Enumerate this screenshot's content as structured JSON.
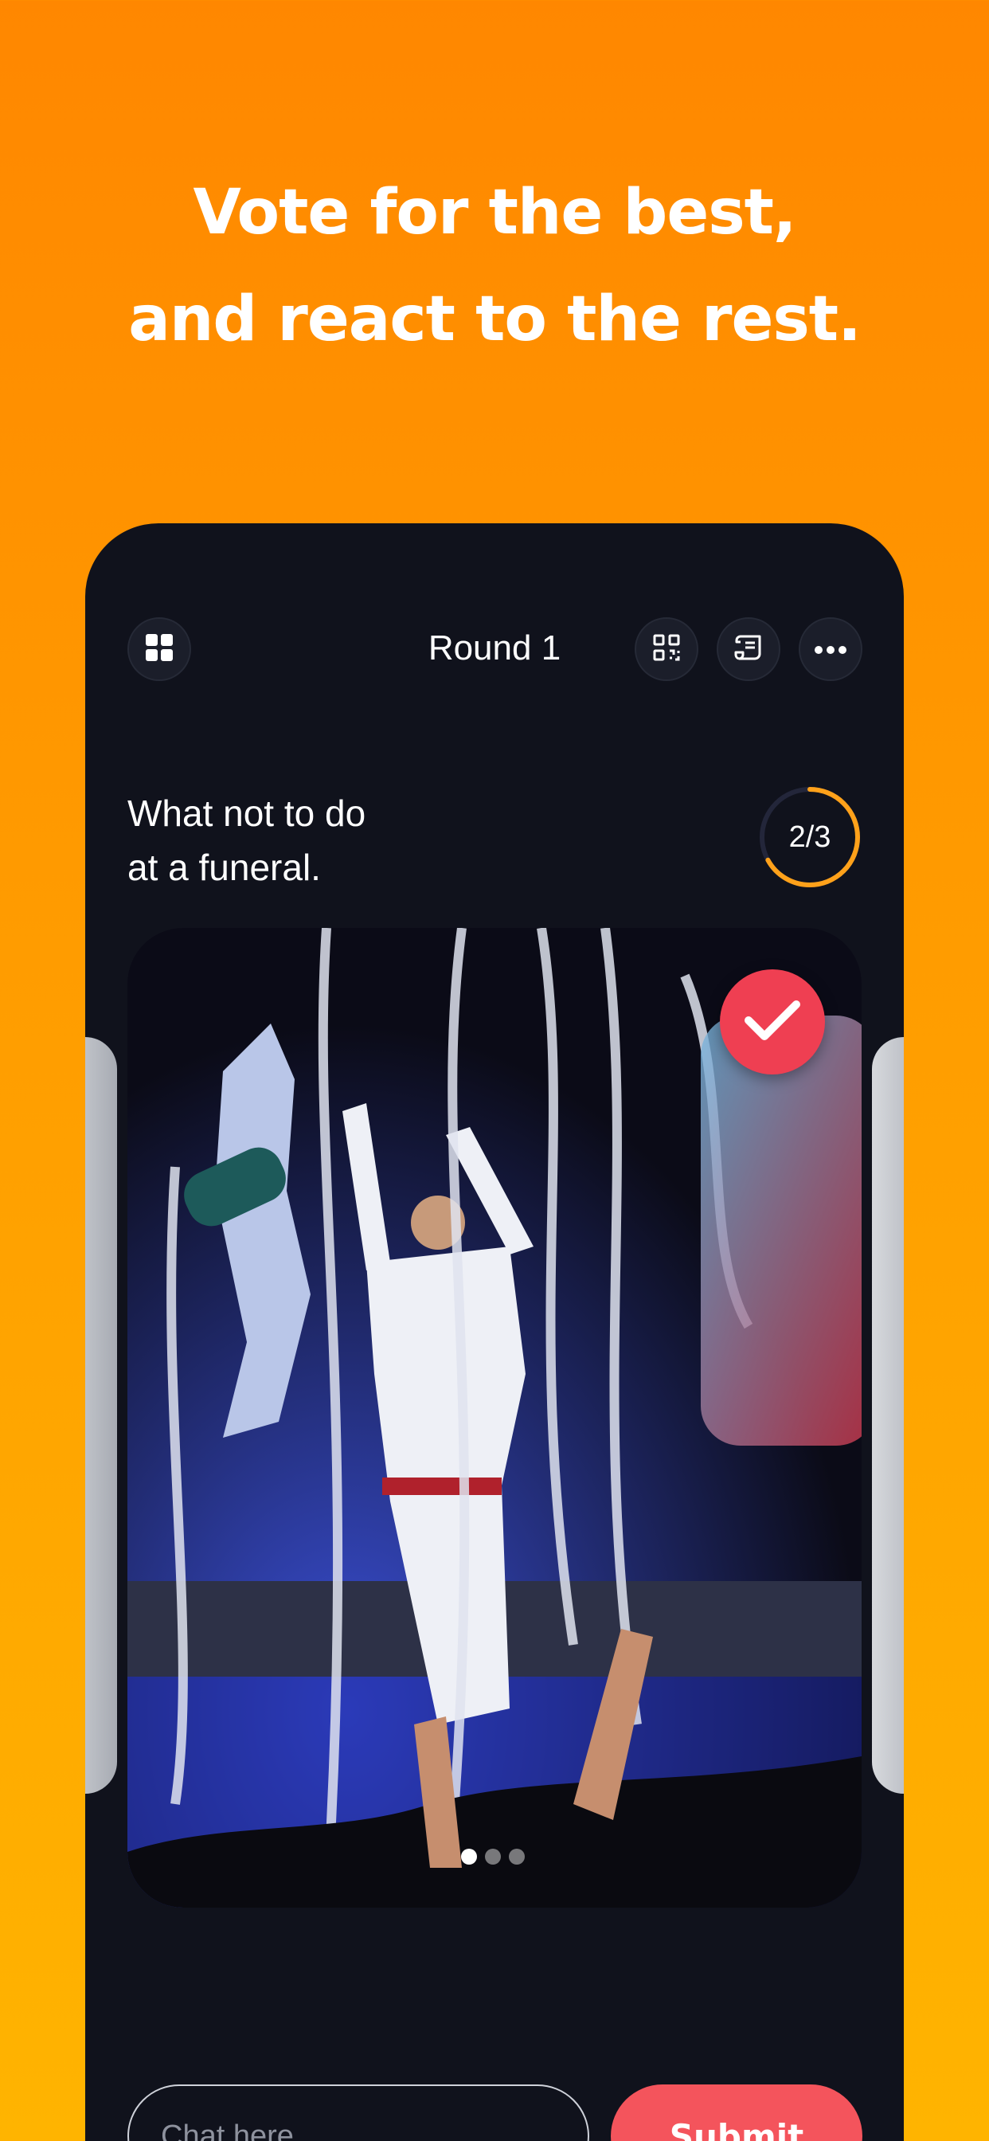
{
  "headline": {
    "line1": "Vote for the best,",
    "line2": "and react to the rest."
  },
  "topbar": {
    "title": "Round 1",
    "icons": [
      "grid-icon",
      "qr-code-icon",
      "scroll-icon",
      "more-icon"
    ]
  },
  "prompt": {
    "line1": "What not to do",
    "line2": "at a funeral."
  },
  "progress": {
    "label": "2/3",
    "value": 0.67
  },
  "carousel": {
    "slides": 3,
    "active_index": 0,
    "selected": true
  },
  "chat": {
    "placeholder": "Chat here",
    "submit_label": "Submit"
  },
  "colors": {
    "background_top": "#ff8700",
    "background_bottom": "#ffb400",
    "phone_bg": "#10121c",
    "accent_red": "#ef3f52",
    "submit_red": "#f4545c",
    "progress_orange": "#ffa11a"
  }
}
